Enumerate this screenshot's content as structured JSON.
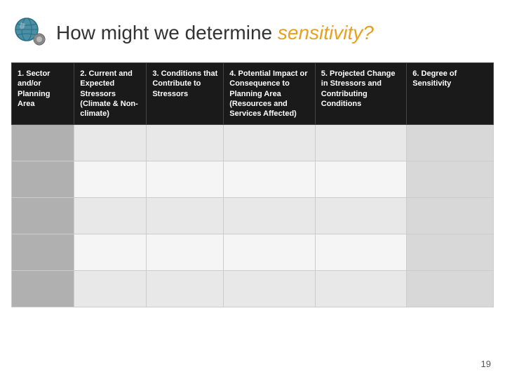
{
  "header": {
    "title_prefix": "How might we determine ",
    "title_highlight": "sensitivity?",
    "logo_alt": "globe-gear-icon"
  },
  "table": {
    "columns": [
      {
        "id": "c1",
        "label": "1. Sector and/or Planning Area"
      },
      {
        "id": "c2",
        "label": "2. Current and Expected Stressors (Climate & Non-climate)"
      },
      {
        "id": "c3",
        "label": "3. Conditions that Contribute to Stressors"
      },
      {
        "id": "c4",
        "label": "4. Potential Impact or Consequence to Planning Area (Resources and Services Affected)"
      },
      {
        "id": "c5",
        "label": "5. Projected Change in Stressors and Contributing Conditions"
      },
      {
        "id": "c6",
        "label": "6. Degree of Sensitivity"
      }
    ],
    "rows": [
      [
        "",
        "",
        "",
        "",
        "",
        ""
      ],
      [
        "",
        "",
        "",
        "",
        "",
        ""
      ],
      [
        "",
        "",
        "",
        "",
        "",
        ""
      ],
      [
        "",
        "",
        "",
        "",
        "",
        ""
      ],
      [
        "",
        "",
        "",
        "",
        "",
        ""
      ]
    ]
  },
  "page_number": "19"
}
